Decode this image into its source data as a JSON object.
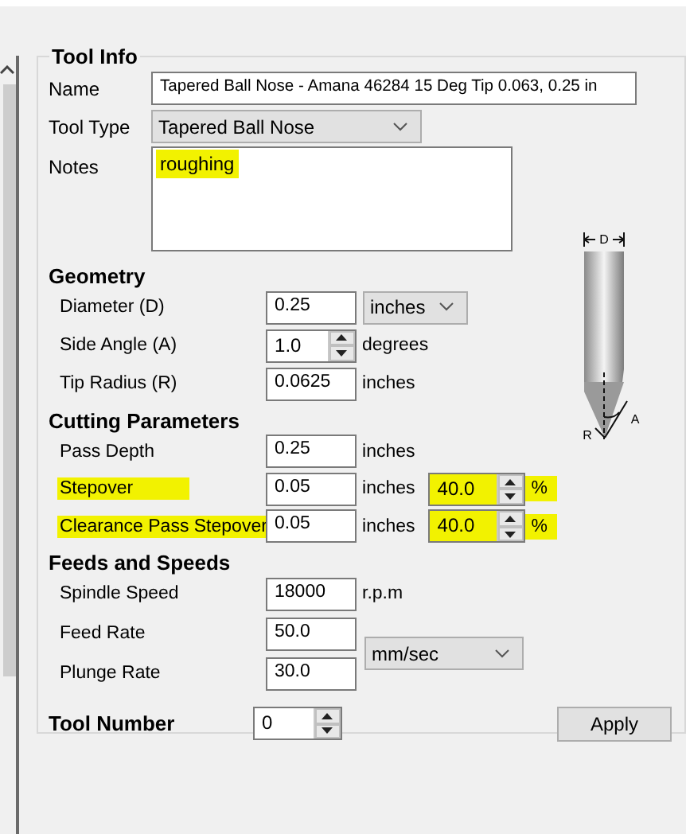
{
  "tool_info": {
    "title": "Tool Info",
    "name": {
      "label": "Name",
      "value": "Tapered Ball Nose - Amana 46284 15 Deg Tip 0.063, 0.25 in"
    },
    "tool_type": {
      "label": "Tool Type",
      "value": "Tapered Ball Nose"
    },
    "notes": {
      "label": "Notes",
      "value": "roughing",
      "highlighted": true
    }
  },
  "diagram": {
    "labels": [
      "D",
      "R",
      "A"
    ]
  },
  "sections": [
    {
      "title": "Geometry",
      "rows": [
        {
          "label": "Diameter (D)",
          "kind": "text",
          "value": "0.25",
          "unit_dropdown": "inches",
          "highlighted": false
        },
        {
          "label": "Side Angle (A)",
          "kind": "spin",
          "value": "1.0",
          "unit": "degrees",
          "highlighted": false
        },
        {
          "label": "Tip Radius (R)",
          "kind": "text",
          "value": "0.0625",
          "unit": "inches",
          "highlighted": false
        }
      ]
    },
    {
      "title": "Cutting Parameters",
      "rows": [
        {
          "label": "Pass Depth",
          "kind": "text",
          "value": "0.25",
          "unit": "inches",
          "highlighted": false
        },
        {
          "label": "Stepover",
          "kind": "text",
          "value": "0.05",
          "unit": "inches",
          "highlighted": true,
          "percent": {
            "value": "40.0",
            "unit": "%",
            "highlighted": true
          }
        },
        {
          "label": "Clearance Pass Stepover",
          "kind": "text",
          "value": "0.05",
          "unit": "inches",
          "highlighted": true,
          "percent": {
            "value": "40.0",
            "unit": "%",
            "highlighted": true
          }
        }
      ]
    },
    {
      "title": "Feeds and Speeds",
      "rows": [
        {
          "label": "Spindle Speed",
          "kind": "text",
          "value": "18000",
          "unit": "r.p.m",
          "highlighted": false
        },
        {
          "label": "Feed Rate",
          "kind": "text",
          "value": "50.0",
          "highlighted": false
        },
        {
          "label": "Plunge Rate",
          "kind": "text",
          "value": "30.0",
          "highlighted": false
        }
      ],
      "rate_units": "mm/sec"
    }
  ],
  "tool_number": {
    "label": "Tool Number",
    "value": "0"
  },
  "apply_button": "Apply"
}
